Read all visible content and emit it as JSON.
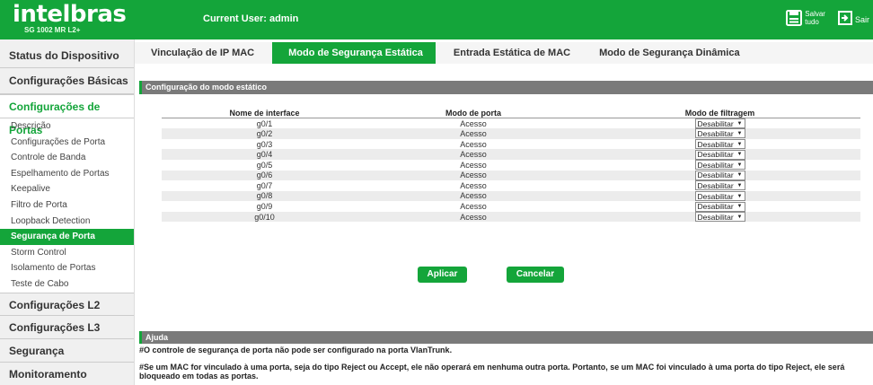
{
  "header": {
    "brand": "intelbras",
    "model": "SG 1002 MR L2+",
    "current_user": "Current User: admin",
    "save_label_line1": "Salvar",
    "save_label_line2": "tudo",
    "exit_label": "Sair"
  },
  "sidebar": {
    "status": "Status do Dispositivo",
    "basic": "Configurações Básicas",
    "ports": "Configurações de Portas",
    "port_items": [
      "Descrição",
      "Configurações de Porta",
      "Controle de Banda",
      "Espelhamento de Portas",
      "Keepalive",
      "Filtro de Porta",
      "Loopback Detection",
      "Segurança de Porta",
      "Storm Control",
      "Isolamento de Portas",
      "Teste de Cabo"
    ],
    "l2": "Configurações L2",
    "l3": "Configurações L3",
    "security": "Segurança",
    "monitoring": "Monitoramento"
  },
  "tabs": [
    "Vinculação de IP MAC",
    "Modo de Segurança Estática",
    "Entrada Estática de MAC",
    "Modo de Segurança Dinâmica"
  ],
  "section_title": "Configuração do modo estático",
  "table": {
    "headers": [
      "Nome de interface",
      "Modo de porta",
      "Modo de filtragem"
    ],
    "rows": [
      {
        "iface": "g0/1",
        "mode": "Acesso",
        "filter": "Desabilitar"
      },
      {
        "iface": "g0/2",
        "mode": "Acesso",
        "filter": "Desabilitar"
      },
      {
        "iface": "g0/3",
        "mode": "Acesso",
        "filter": "Desabilitar"
      },
      {
        "iface": "g0/4",
        "mode": "Acesso",
        "filter": "Desabilitar"
      },
      {
        "iface": "g0/5",
        "mode": "Acesso",
        "filter": "Desabilitar"
      },
      {
        "iface": "g0/6",
        "mode": "Acesso",
        "filter": "Desabilitar"
      },
      {
        "iface": "g0/7",
        "mode": "Acesso",
        "filter": "Desabilitar"
      },
      {
        "iface": "g0/8",
        "mode": "Acesso",
        "filter": "Desabilitar"
      },
      {
        "iface": "g0/9",
        "mode": "Acesso",
        "filter": "Desabilitar"
      },
      {
        "iface": "g0/10",
        "mode": "Acesso",
        "filter": "Desabilitar"
      }
    ]
  },
  "buttons": {
    "apply": "Aplicar",
    "cancel": "Cancelar"
  },
  "help": {
    "title": "Ajuda",
    "line1": "#O controle de segurança de porta não pode ser configurado na porta VlanTrunk.",
    "line2": "#Se um MAC for vinculado à uma porta, seja do tipo Reject ou Accept, ele não operará em nenhuma outra porta. Portanto, se um MAC foi vinculado à uma porta do tipo Reject, ele será bloqueado em todas as portas."
  },
  "colors": {
    "brand_green": "#14a53a",
    "section_gray": "#7a7a7a"
  }
}
